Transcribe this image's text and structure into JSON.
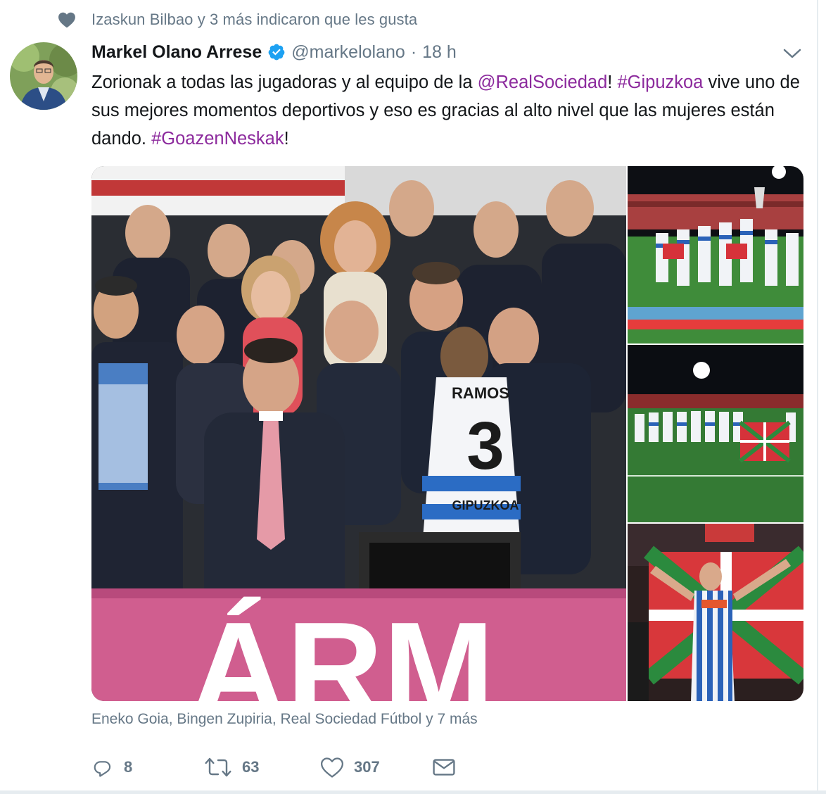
{
  "social_context": {
    "text": "Izaskun Bilbao y 3 más indicaron que les gusta",
    "icon": "heart-icon"
  },
  "tweet": {
    "author": {
      "name": "Markel Olano Arrese",
      "verified": true,
      "handle": "@markelolano",
      "separator": "·",
      "time": "18 h"
    },
    "text_parts": [
      {
        "text": "Zorionak a todas las jugadoras y al equipo de la ",
        "type": "text"
      },
      {
        "text": "@RealSociedad",
        "type": "mention"
      },
      {
        "text": "! ",
        "type": "text"
      },
      {
        "text": "#Gipuzkoa",
        "type": "hashtag"
      },
      {
        "text": " vive uno de sus mejores momentos deportivos y eso es gracias al alto nivel que las mujeres están dando. ",
        "type": "text"
      },
      {
        "text": "#GoazenNeskak",
        "type": "hashtag"
      },
      {
        "text": "!",
        "type": "text"
      }
    ],
    "media": {
      "main_jersey_name": "RAMOS",
      "main_jersey_number": "3",
      "main_sponsor": "GIPUZKOA",
      "banner_text": "ÁRM",
      "photos": [
        "celebration-on-pitch-photo",
        "team-photo-with-flag",
        "player-with-ikurrina-photo"
      ]
    },
    "liked_by": "Eneko Goia, Bingen Zupiria, Real Sociedad Fútbol y 7 más",
    "stats": {
      "replies": "8",
      "retweets": "63",
      "likes": "307"
    }
  },
  "colors": {
    "link": "#8c2a9d",
    "secondary_text": "#657786",
    "primary_text": "#14171a",
    "verified": "#1da1f2"
  }
}
